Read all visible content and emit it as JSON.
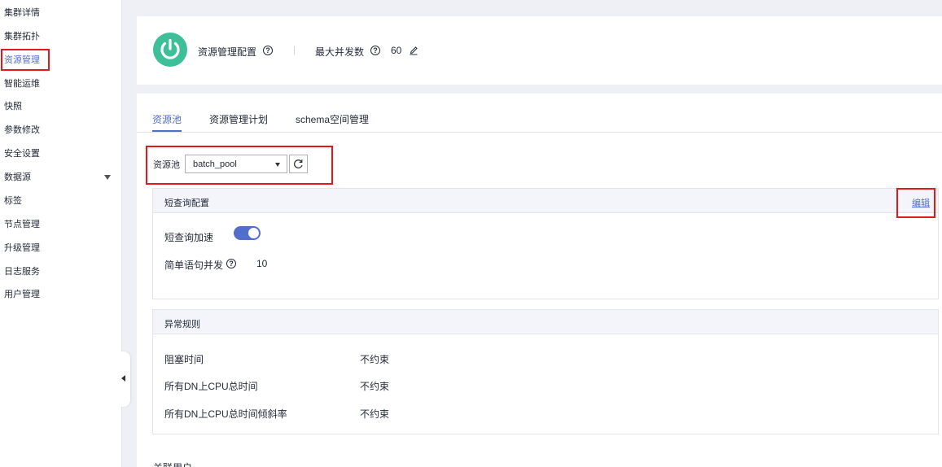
{
  "sidebar": {
    "items": [
      {
        "label": "集群详情"
      },
      {
        "label": "集群拓扑"
      },
      {
        "label": "资源管理"
      },
      {
        "label": "智能运维"
      },
      {
        "label": "快照"
      },
      {
        "label": "参数修改"
      },
      {
        "label": "安全设置"
      },
      {
        "label": "数据源"
      },
      {
        "label": "标签"
      },
      {
        "label": "节点管理"
      },
      {
        "label": "升级管理"
      },
      {
        "label": "日志服务"
      },
      {
        "label": "用户管理"
      }
    ],
    "active_index": 2,
    "expandable_item": "数据源"
  },
  "header": {
    "title": "资源管理配置",
    "max_concurrency_label": "最大并发数",
    "max_concurrency_value": "60",
    "icon": "power-icon",
    "help_glyph": "?"
  },
  "tabs": [
    {
      "label": "资源池"
    },
    {
      "label": "资源管理计划"
    },
    {
      "label": "schema空间管理"
    }
  ],
  "pool_selector": {
    "label": "资源池",
    "value": "batch_pool"
  },
  "short_query": {
    "title": "短查询配置",
    "edit_label": "编辑",
    "accel_label": "短查询加速",
    "accel_enabled": true,
    "concurrency_label": "简单语句并发",
    "concurrency_value": "10"
  },
  "exception_rules": {
    "title": "异常规则",
    "rows": [
      {
        "label": "阻塞时间",
        "value": "不约束"
      },
      {
        "label": "所有DN上CPU总时间",
        "value": "不约束"
      },
      {
        "label": "所有DN上CPU总时间倾斜率",
        "value": "不约束"
      }
    ]
  },
  "footer_partial": "关联用户",
  "colors": {
    "accent": "#526ecc",
    "power": "#3dbf9a",
    "highlight_box": "#e0191d"
  }
}
